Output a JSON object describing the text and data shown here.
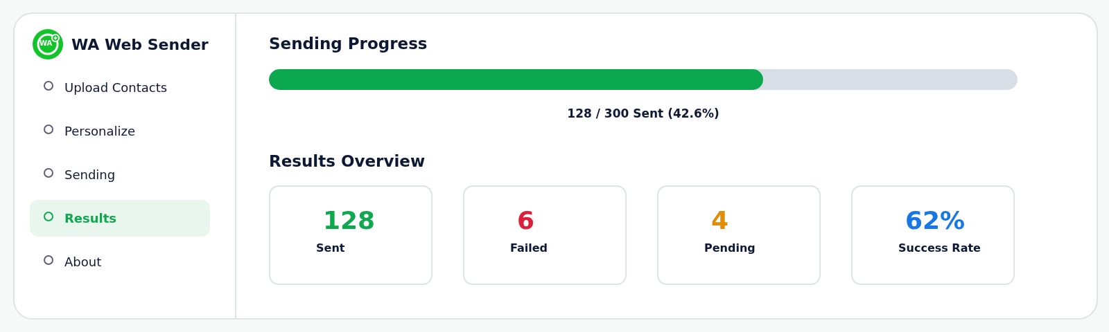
{
  "app": {
    "logo_text": "WA",
    "title": "WA Web Sender"
  },
  "sidebar": {
    "items": [
      {
        "label": "Upload Contacts",
        "selected": false
      },
      {
        "label": "Personalize",
        "selected": false
      },
      {
        "label": "Sending",
        "selected": false
      },
      {
        "label": "Results",
        "selected": true
      },
      {
        "label": "About",
        "selected": false
      }
    ]
  },
  "progress": {
    "title": "Sending Progress",
    "level": 0.66,
    "caption": "128 / 300 Sent (42.6%)"
  },
  "results": {
    "title": "Results Overview",
    "stats": [
      {
        "value": "128",
        "label": "Sent",
        "color": "#0ea84f"
      },
      {
        "value": "6",
        "label": "Failed",
        "color": "#dc1f3a"
      },
      {
        "value": "4",
        "label": "Pending",
        "color": "#e38d07"
      },
      {
        "value": "62%",
        "label": "Success Rate",
        "color": "#1677e5"
      }
    ]
  }
}
